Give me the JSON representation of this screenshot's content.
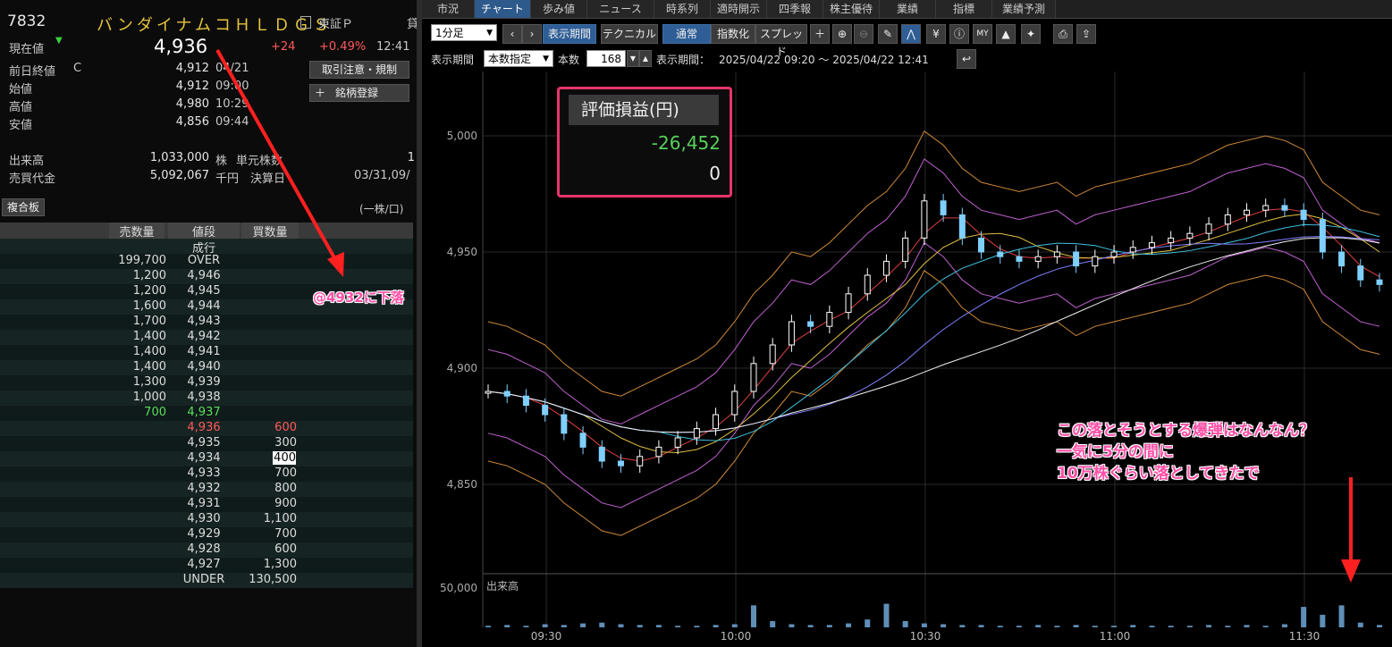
{
  "stock": {
    "code": "7832",
    "name": "バンダイナムコＨＬＤＧＳ",
    "market": "東証Ｐ",
    "market_extra": "貸",
    "current_label": "現在値",
    "current_price": "4,936",
    "change": "+24",
    "change_pct": "+0.49%",
    "time": "12:41",
    "prev_close_label": "前日終値",
    "prev_close_flag": "C",
    "prev_close": "4,912",
    "prev_close_date": "04/21",
    "open_label": "始値",
    "open": "4,912",
    "open_time": "09:00",
    "high_label": "高値",
    "high": "4,980",
    "high_time": "10:29",
    "low_label": "安値",
    "low": "4,856",
    "low_time": "09:44",
    "volume_label": "出来高",
    "volume": "1,033,000",
    "volume_unit": "株",
    "unit_label": "単元株数",
    "unit_value": "1",
    "turnover_label": "売買代金",
    "turnover": "5,092,067",
    "turnover_unit": "千円",
    "settle_label": "決算日",
    "settle_value": "03/31,09/"
  },
  "buttons": {
    "trade_notice": "取引注意・規制",
    "register": "銘柄登録",
    "composite": "複合板",
    "per_share": "(一株/口)"
  },
  "book": {
    "headers": [
      "売数量",
      "値段",
      "買数量"
    ],
    "market_order": "成行",
    "rows": [
      {
        "sell": "199,700",
        "price": "OVER",
        "buy": ""
      },
      {
        "sell": "1,200",
        "price": "4,946",
        "buy": ""
      },
      {
        "sell": "1,200",
        "price": "4,945",
        "buy": ""
      },
      {
        "sell": "1,600",
        "price": "4,944",
        "buy": ""
      },
      {
        "sell": "1,700",
        "price": "4,943",
        "buy": ""
      },
      {
        "sell": "1,400",
        "price": "4,942",
        "buy": ""
      },
      {
        "sell": "1,400",
        "price": "4,941",
        "buy": ""
      },
      {
        "sell": "1,400",
        "price": "4,940",
        "buy": ""
      },
      {
        "sell": "1,300",
        "price": "4,939",
        "buy": ""
      },
      {
        "sell": "1,000",
        "price": "4,938",
        "buy": ""
      },
      {
        "sell": "700",
        "price": "4,937",
        "buy": ""
      },
      {
        "sell": "",
        "price": "4,936",
        "buy": "600"
      },
      {
        "sell": "",
        "price": "4,935",
        "buy": "300"
      },
      {
        "sell": "",
        "price": "4,934",
        "buy": "400"
      },
      {
        "sell": "",
        "price": "4,933",
        "buy": "700"
      },
      {
        "sell": "",
        "price": "4,932",
        "buy": "800"
      },
      {
        "sell": "",
        "price": "4,931",
        "buy": "900"
      },
      {
        "sell": "",
        "price": "4,930",
        "buy": "1,100"
      },
      {
        "sell": "",
        "price": "4,929",
        "buy": "700"
      },
      {
        "sell": "",
        "price": "4,928",
        "buy": "600"
      },
      {
        "sell": "",
        "price": "4,927",
        "buy": "1,300"
      },
      {
        "sell": "",
        "price": "UNDER",
        "buy": "130,500"
      }
    ]
  },
  "tabs": [
    "市況",
    "チャート",
    "歩み値",
    "ニュース",
    "時系列",
    "適時開示",
    "四季報",
    "株主優待",
    "業績",
    "指標",
    "業績予測"
  ],
  "toolbar": {
    "interval": "1分足",
    "period_btn": "表示期間",
    "technical_btn": "テクニカル",
    "normal_btn": "通常",
    "index_btn": "指数化",
    "spread_btn": "スプレッド",
    "period_label": "表示期間",
    "count_mode": "本数指定",
    "count_label": "本数",
    "count_value": "168",
    "range_label": "表示期間：",
    "range_value": "2025/04/22 09:20 ～ 2025/04/22 12:41"
  },
  "pnl": {
    "label": "評価損益(円)",
    "value": "-26,452",
    "value2": "0"
  },
  "annotations": {
    "left_note": "@4932に下落",
    "right_line1": "この落とそうとする爆弾はなんなん？",
    "right_line2": "一気に5分の間に",
    "right_line3": "10万株ぐらい落としてきたで",
    "accent_color": "#ff4fa6",
    "arrow_color": "#ff2020"
  },
  "chart_data": {
    "type": "line",
    "x_ticks": [
      "09:30",
      "10:00",
      "10:30",
      "11:00",
      "11:30"
    ],
    "y_ticks": [
      4850,
      4900,
      4950,
      5000
    ],
    "ylim": [
      4820,
      5020
    ],
    "volume_label": "出来高",
    "volume_tick": "50,000",
    "series": [
      {
        "values": [
          4890,
          4888,
          4884,
          4880,
          4872,
          4866,
          4860,
          4858,
          4862,
          4866,
          4870,
          4874,
          4880,
          4890,
          4902,
          4910,
          4920,
          4918,
          4924,
          4932,
          4940,
          4946,
          4956,
          4972,
          4966,
          4956,
          4950,
          4948,
          4946,
          4948,
          4950,
          4944,
          4948,
          4950,
          4952,
          4954,
          4956,
          4958,
          4962,
          4966,
          4968,
          4970,
          4968,
          4964,
          4950,
          4944,
          4938,
          4936
        ]
      }
    ],
    "volume": [
      2,
      3,
      2,
      4,
      3,
      5,
      6,
      4,
      3,
      3,
      2,
      2,
      3,
      4,
      28,
      8,
      4,
      3,
      3,
      5,
      10,
      30,
      8,
      5,
      4,
      3,
      3,
      2,
      2,
      3,
      2,
      3,
      2,
      2,
      3,
      2,
      2,
      2,
      3,
      2,
      3,
      2,
      4,
      26,
      16,
      28,
      6,
      3
    ]
  }
}
